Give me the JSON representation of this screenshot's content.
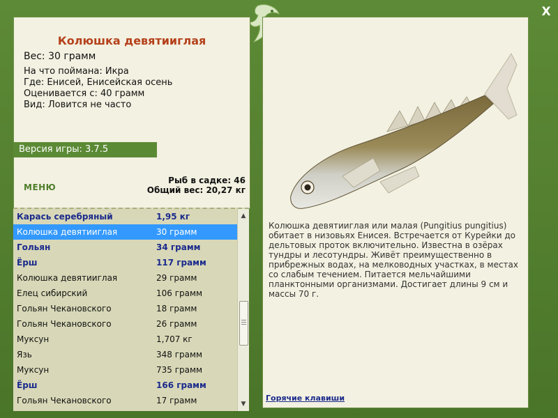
{
  "window": {
    "close_label": "X"
  },
  "fish": {
    "title": "Колюшка девятииглая",
    "weight": "Вес: 30 грамм",
    "bait": "На что поймана: Икра",
    "location": "Где: Енисей, Енисейская осень",
    "valued_from": "Оценивается с: 40 грамм",
    "kind": "Вид: Ловится не часто",
    "description": "Колюшка девятииглая или малая (Pungitius pungitius) обитает в низовьях Енисея. Встречается от Курейки до дельтовых проток включительно. Известна в озёрах тундры и лесотундры. Живёт преимущественно в прибрежных водах, на мелководных участках, в местах со слабым течением. Питается мельчайшими планктонными организмами. Достигает длины 9 см и массы 70 г."
  },
  "game": {
    "version": "Версия игры: 3.7.5"
  },
  "menu": {
    "label": "МЕНЮ"
  },
  "keepnet": {
    "count_label": "Рыб в садке: 46",
    "total_label": "Общий вес: 20,27 кг"
  },
  "catch_list": [
    {
      "name": "Карась серебряный",
      "weight": "1,95 кг",
      "bold": true,
      "selected": false
    },
    {
      "name": "Колюшка девятииглая",
      "weight": "30 грамм",
      "bold": false,
      "selected": true
    },
    {
      "name": "Гольян",
      "weight": "34 грамм",
      "bold": true,
      "selected": false
    },
    {
      "name": "Ёрш",
      "weight": "117 грамм",
      "bold": true,
      "selected": false
    },
    {
      "name": "Колюшка девятииглая",
      "weight": "29 грамм",
      "bold": false,
      "selected": false
    },
    {
      "name": "Елец сибирский",
      "weight": "106 грамм",
      "bold": false,
      "selected": false
    },
    {
      "name": "Гольян Чекановского",
      "weight": "18 грамм",
      "bold": false,
      "selected": false
    },
    {
      "name": "Гольян Чекановского",
      "weight": "26 грамм",
      "bold": false,
      "selected": false
    },
    {
      "name": "Муксун",
      "weight": "1,707 кг",
      "bold": false,
      "selected": false
    },
    {
      "name": "Язь",
      "weight": "348 грамм",
      "bold": false,
      "selected": false
    },
    {
      "name": "Муксун",
      "weight": "735 грамм",
      "bold": false,
      "selected": false
    },
    {
      "name": "Ёрш",
      "weight": "166 грамм",
      "bold": true,
      "selected": false
    },
    {
      "name": "Гольян Чекановского",
      "weight": "17 грамм",
      "bold": false,
      "selected": false
    }
  ],
  "links": {
    "hotkeys": "Горячие клавиши"
  },
  "colors": {
    "frame": "#4f7a2e",
    "panel": "#f3f1e1",
    "title": "#b5411c",
    "selected": "#3399ff",
    "bold_text": "#1b2a8c"
  }
}
